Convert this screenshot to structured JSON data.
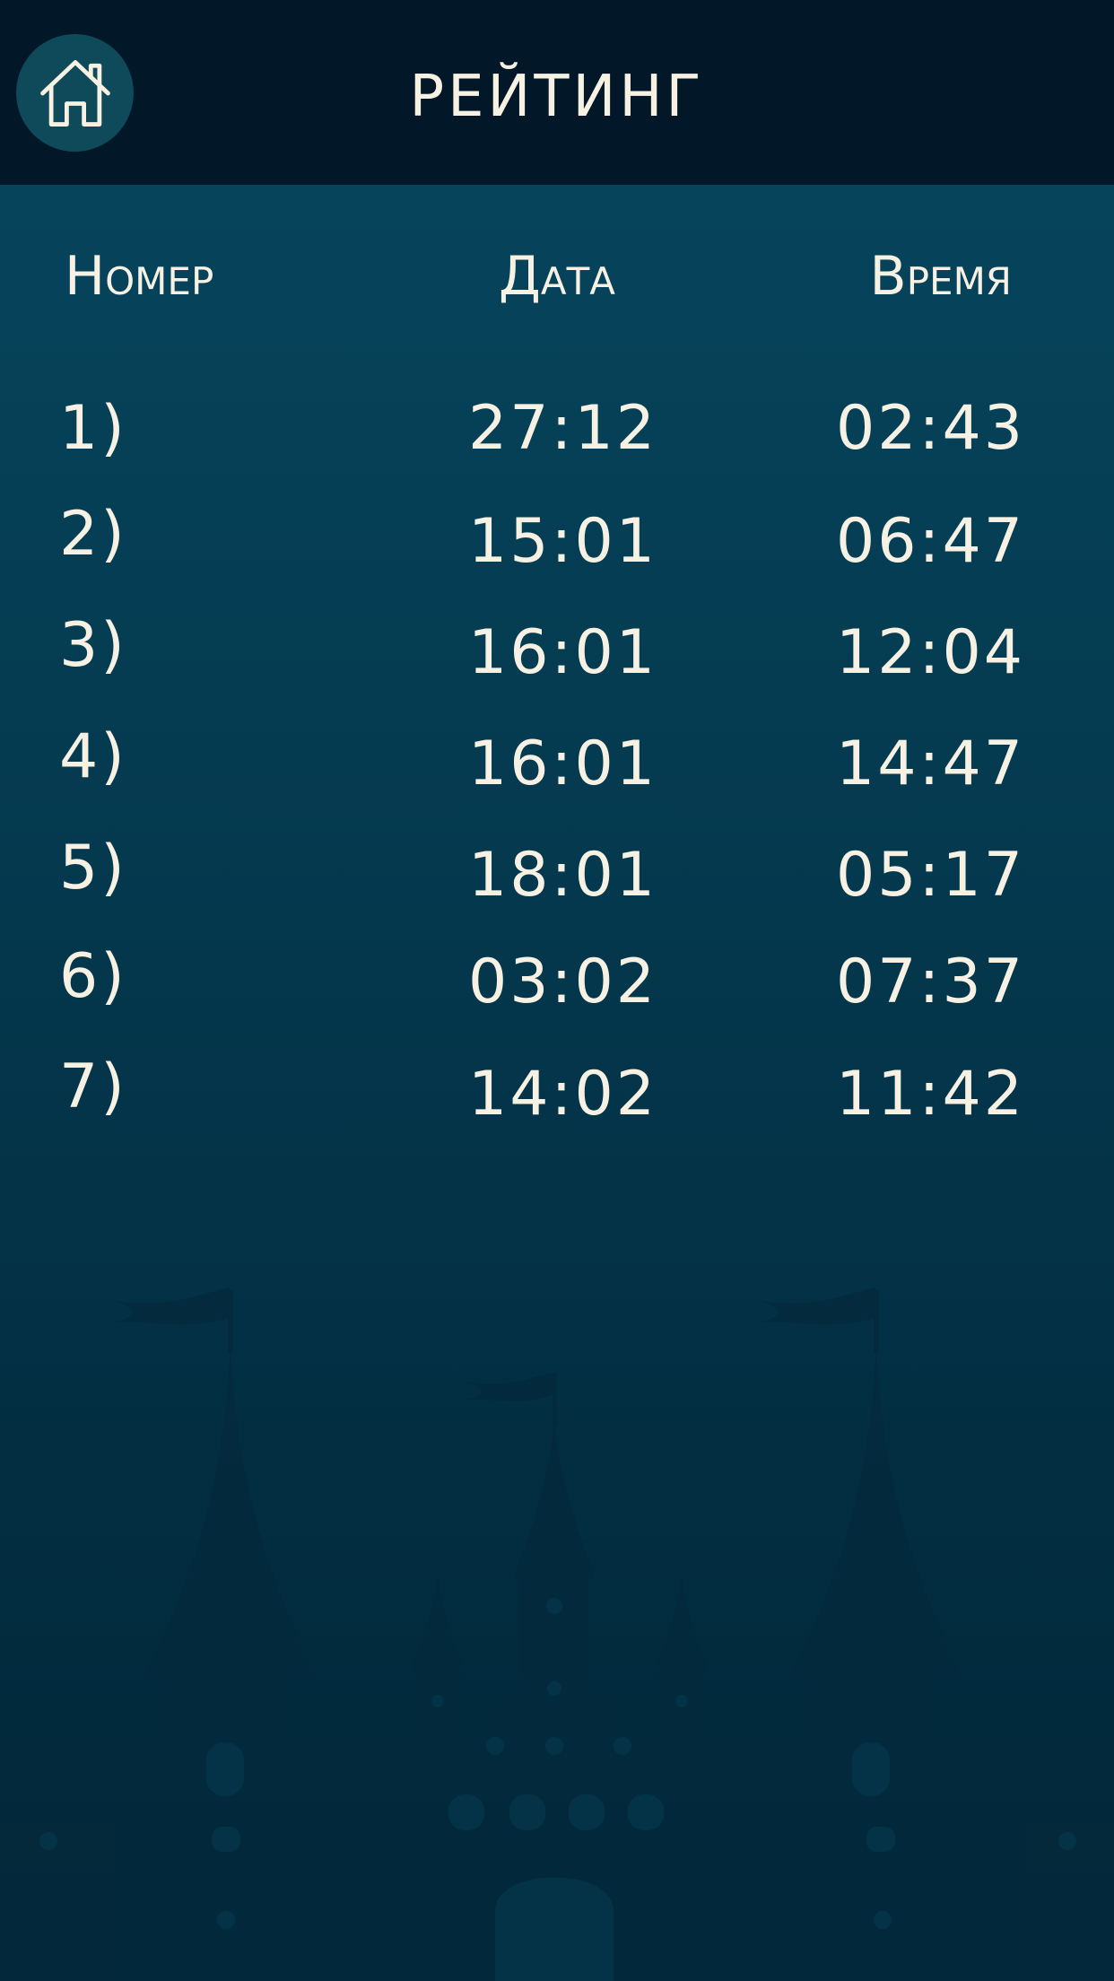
{
  "header": {
    "title": "РЕЙТИНГ",
    "home_icon": "home-icon"
  },
  "table": {
    "columns": {
      "number": "Номер",
      "date": "Дата",
      "time": "Время"
    },
    "rows": [
      {
        "num": "1)",
        "date": "27:12",
        "time": "02:43"
      },
      {
        "num": "2)",
        "date": "15:01",
        "time": "06:47"
      },
      {
        "num": "3)",
        "date": "16:01",
        "time": "12:04"
      },
      {
        "num": "4)",
        "date": "16:01",
        "time": "14:47"
      },
      {
        "num": "5)",
        "date": "18:01",
        "time": "05:17"
      },
      {
        "num": "6)",
        "date": "03:02",
        "time": "07:37"
      },
      {
        "num": "7)",
        "date": "14:02",
        "time": "11:42"
      }
    ]
  },
  "colors": {
    "header_bg": "#021828",
    "background_top": "#06475f",
    "background_bottom": "#022638",
    "text": "#f6f1e3",
    "home_button_bg": "#0f4a5a"
  }
}
